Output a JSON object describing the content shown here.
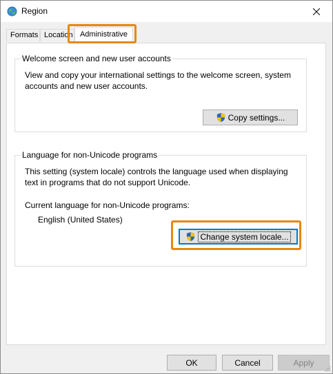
{
  "window": {
    "title": "Region",
    "icon": "globe-icon",
    "close_icon": "close-icon"
  },
  "tabs": [
    {
      "label": "Formats",
      "selected": false
    },
    {
      "label": "Location",
      "selected": false
    },
    {
      "label": "Administrative",
      "selected": true
    }
  ],
  "welcome_group": {
    "title": "Welcome screen and new user accounts",
    "description_line1": "View and copy your international settings to the welcome screen, system",
    "description_line2": "accounts and new user accounts.",
    "copy_button_label": "Copy settings...",
    "button_icon": "uac-shield-icon"
  },
  "language_group": {
    "title": "Language for non-Unicode programs",
    "description_line1": "This setting (system locale) controls the language used when displaying",
    "description_line2": "text in programs that do not support Unicode.",
    "current_label": "Current language for non-Unicode programs:",
    "current_value": "English (United States)",
    "change_button_label": "Change system locale...",
    "button_icon": "uac-shield-icon"
  },
  "footer": {
    "ok_label": "OK",
    "cancel_label": "Cancel",
    "apply_label": "Apply"
  },
  "colors": {
    "highlight": "#e8870c",
    "focus_border": "#0078d7",
    "dialog_bg": "#f0f0f0"
  }
}
